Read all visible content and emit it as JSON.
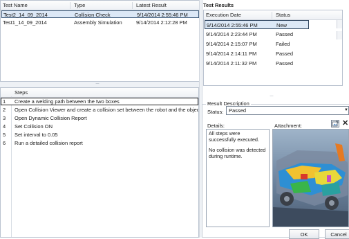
{
  "tests_table": {
    "columns": [
      "Test Name",
      "Type",
      "Latest Result"
    ],
    "rows": [
      {
        "name": "Test2_14_09_2014",
        "type": "Collision Check",
        "latest": "9/14/2014 2:55:46 PM"
      },
      {
        "name": "Test1_14_09_2014",
        "type": "Assembly Simulation",
        "latest": "9/14/2014 2:12:28 PM"
      }
    ]
  },
  "steps": {
    "header": "Steps",
    "items": [
      {
        "num": "1",
        "text": "Create a welding path between the two boxes"
      },
      {
        "num": "2",
        "text": "Open Collision Viewer and create a collision set between the robot and the objects"
      },
      {
        "num": "3",
        "text": "Open Dynamic Collision Report"
      },
      {
        "num": "4",
        "text": "Set Collision ON"
      },
      {
        "num": "5",
        "text": "Set interval to 0.05"
      },
      {
        "num": "6",
        "text": "Run a detailed collision report"
      }
    ]
  },
  "results": {
    "title": "Test Results",
    "columns": [
      "Execution Date",
      "Status"
    ],
    "rows": [
      {
        "date": "9/14/2014 2:55:46 PM",
        "status": "New"
      },
      {
        "date": "9/14/2014 2:23:44 PM",
        "status": "Passed"
      },
      {
        "date": "9/14/2014 2:15:07 PM",
        "status": "Failed"
      },
      {
        "date": "9/14/2014 2:14:11 PM",
        "status": "Passed"
      },
      {
        "date": "9/14/2014 2:11:32 PM",
        "status": "Passed"
      }
    ]
  },
  "description": {
    "legend": "Result Description",
    "status_label": "Status:",
    "status_value": "Passed",
    "details_label": "Details:",
    "details_line1": "All steps were successfully executed.",
    "details_line2": "No collision was detected during runtime.",
    "attachment_label": "Attachment:"
  },
  "buttons": {
    "ok": "OK",
    "cancel": "Cancel"
  },
  "icons": {
    "attach": "attach-file-icon",
    "remove": "close-icon",
    "grip": "splitter-grip-icon",
    "dropdown": "chevron-down-icon"
  }
}
